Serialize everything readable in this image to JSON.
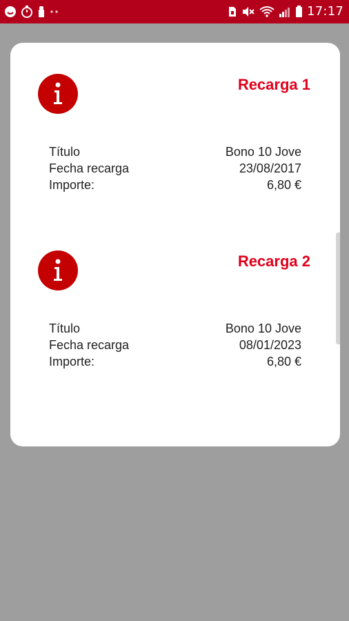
{
  "status_bar": {
    "time": "17:17",
    "left_icons": [
      "face-icon",
      "timer-icon",
      "notification-icon",
      "more-dots-icon"
    ],
    "right_icons": [
      "sim-icon",
      "mute-icon",
      "wifi-icon",
      "signal-icon",
      "battery-icon"
    ],
    "background": "#b3001b"
  },
  "recargas": [
    {
      "title": "Recarga 1",
      "rows": [
        {
          "label": "Título",
          "value": "Bono 10 Jove"
        },
        {
          "label": "Fecha recarga",
          "value": "23/08/2017"
        },
        {
          "label": "Importe:",
          "value": "6,80 €"
        }
      ]
    },
    {
      "title": "Recarga 2",
      "rows": [
        {
          "label": "Título",
          "value": "Bono 10 Jove"
        },
        {
          "label": "Fecha recarga",
          "value": "08/01/2023"
        },
        {
          "label": "Importe:",
          "value": "6,80 €"
        }
      ]
    }
  ],
  "colors": {
    "accent": "#e0001b",
    "icon_bg": "#c40000",
    "card_bg": "#ffffff",
    "page_bg": "#9e9e9e"
  }
}
